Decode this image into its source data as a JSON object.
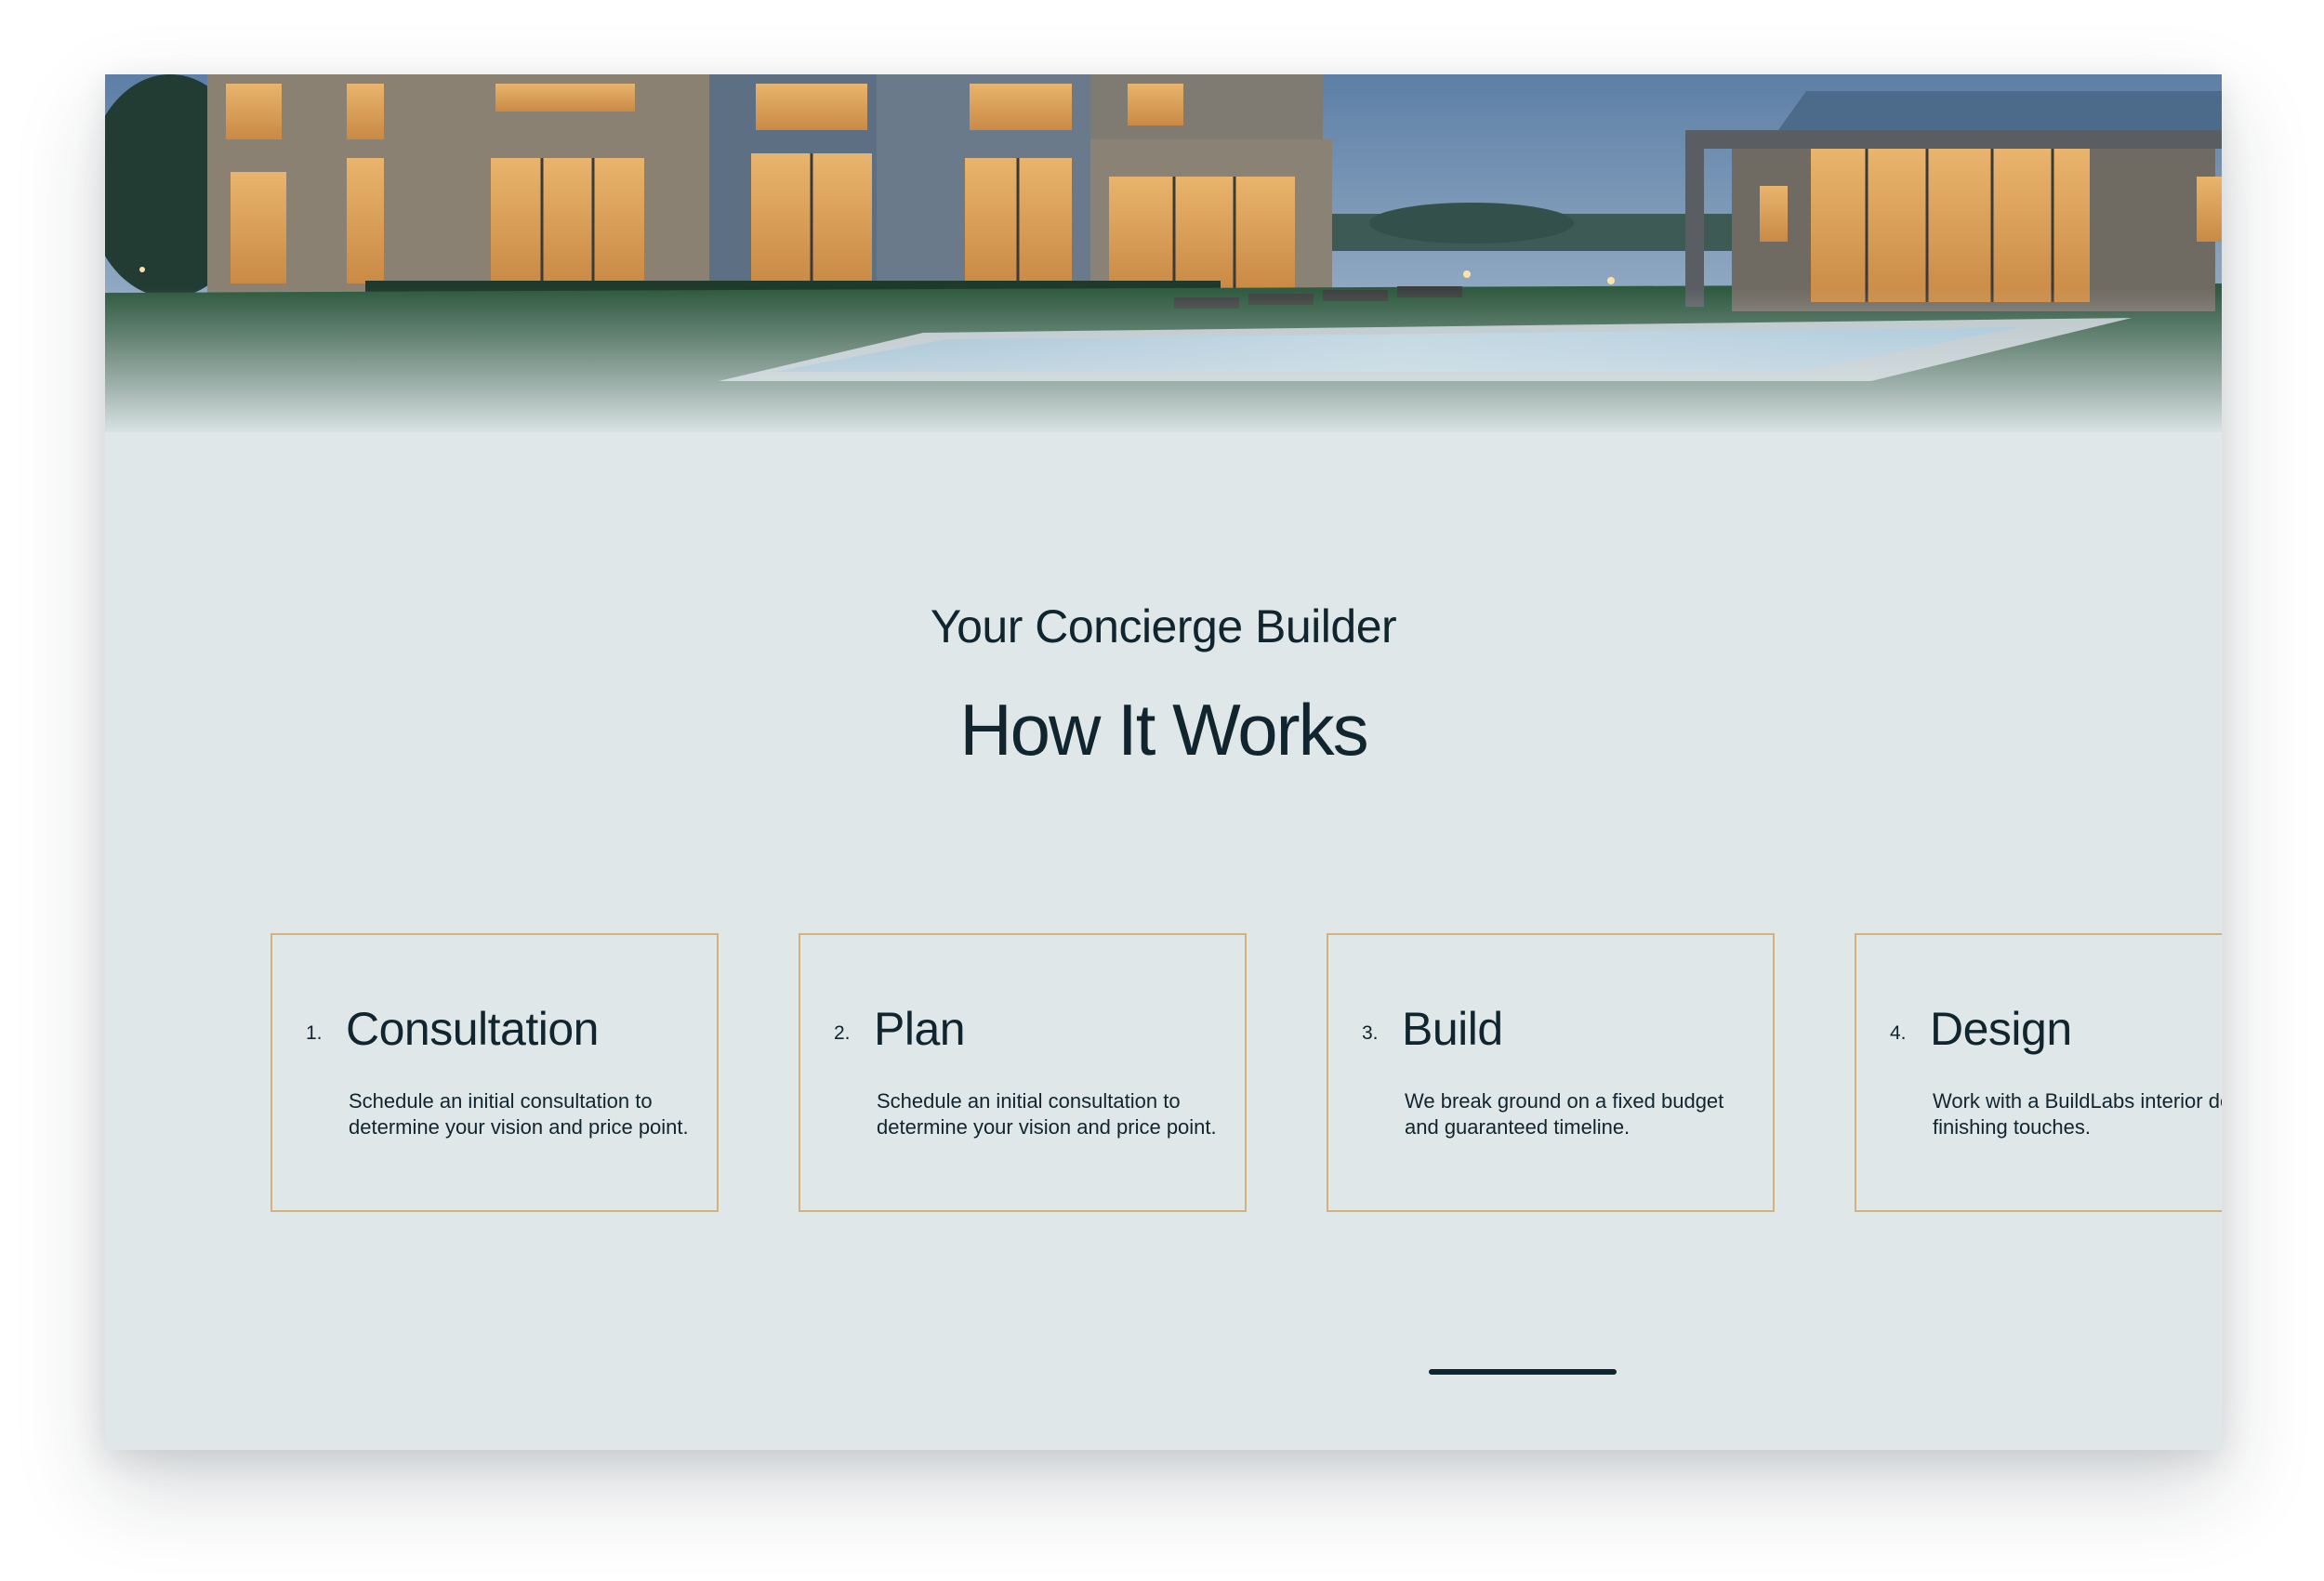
{
  "section": {
    "subtitle": "Your Concierge Builder",
    "title": "How It Works"
  },
  "steps": [
    {
      "number": "1.",
      "title": "Consultation",
      "description": "Schedule an initial consultation to determine your vision and price point."
    },
    {
      "number": "2.",
      "title": "Plan",
      "description": "Schedule an initial consultation to determine your vision and price point."
    },
    {
      "number": "3.",
      "title": "Build",
      "description": "We break ground on a fixed budget and guaranteed timeline."
    },
    {
      "number": "4.",
      "title": "Design",
      "description": "Work with a BuildLabs interior designer for finishing touches."
    }
  ],
  "colors": {
    "background": "#dfe7e9",
    "text": "#10252e",
    "card_border": "#d3b27e",
    "scroll_indicator": "#10252e"
  },
  "carousel": {
    "scroll_position_fraction": 0.75
  }
}
